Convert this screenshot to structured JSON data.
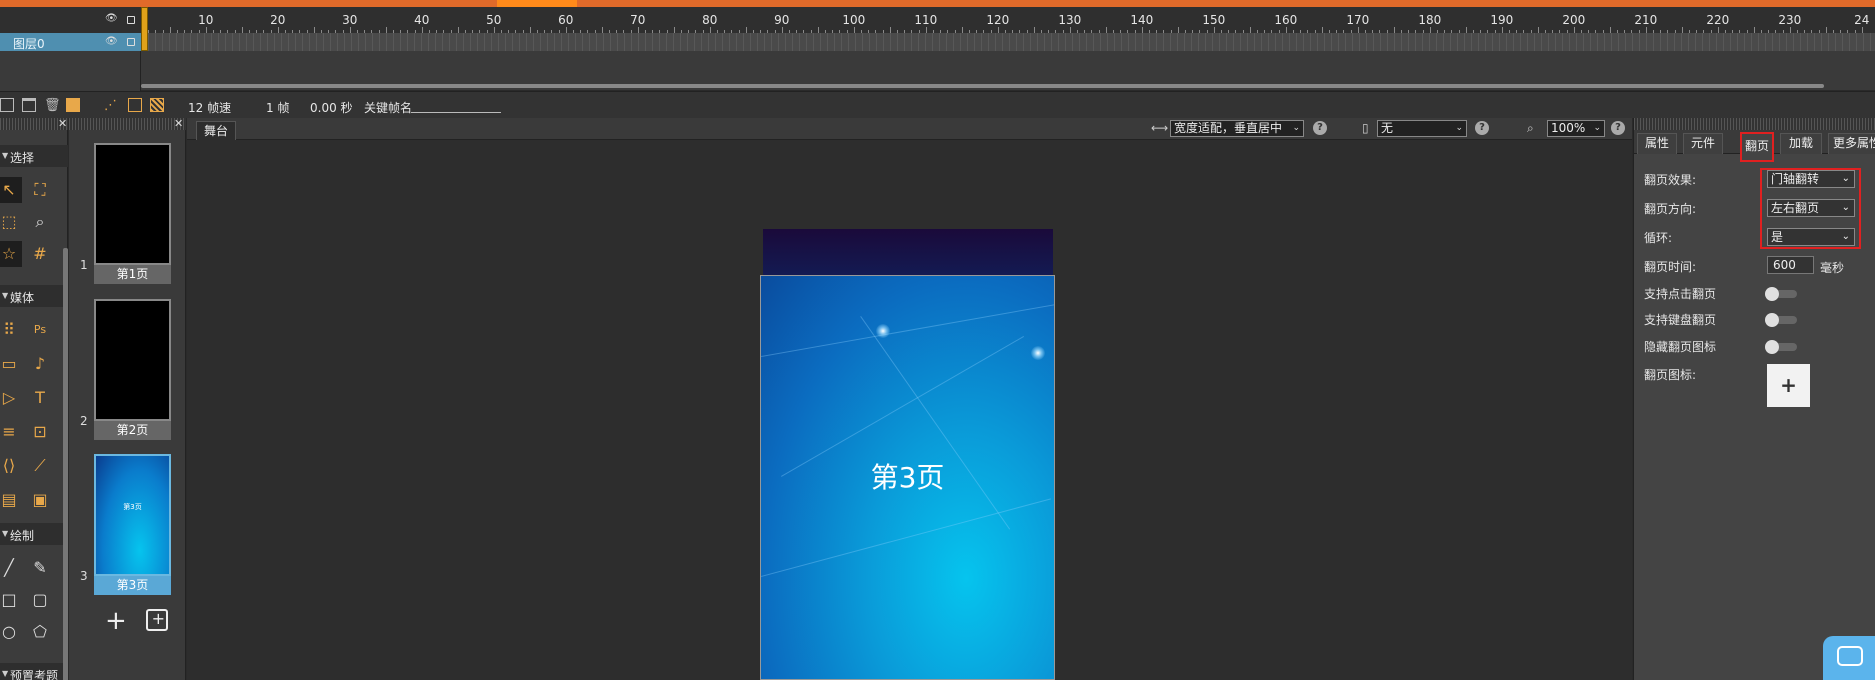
{
  "timeline": {
    "ruler_numbers": [
      "10",
      "20",
      "30",
      "40",
      "50",
      "60",
      "70",
      "80",
      "90",
      "100",
      "110",
      "120",
      "130",
      "140",
      "150",
      "160",
      "170",
      "180",
      "190",
      "200",
      "210",
      "220",
      "230",
      "24"
    ],
    "layer_name": "图层0",
    "status": {
      "fps": "12 帧速",
      "frame": "1 帧",
      "seconds": "0.00 秒",
      "keyframe_label": "关键帧名"
    }
  },
  "tools": {
    "sections": [
      {
        "label": "选择"
      },
      {
        "label": "媒体"
      },
      {
        "label": "绘制"
      },
      {
        "label": "预置考题"
      }
    ]
  },
  "pages": [
    {
      "num": "1",
      "label": "第1页"
    },
    {
      "num": "2",
      "label": "第2页"
    },
    {
      "num": "3",
      "label": "第3页",
      "mini_text": "第3页"
    }
  ],
  "stage": {
    "tab": "舞台",
    "fit_mode": "宽度适配，垂直居中",
    "device": "无",
    "zoom": "100%",
    "help": "?",
    "canvas_title": "第3页"
  },
  "props": {
    "tabs": [
      "属性",
      "元件",
      "翻页",
      "加载",
      "更多属性"
    ],
    "active_tab": "翻页",
    "rows": {
      "effect_label": "翻页效果:",
      "effect_value": "门轴翻转",
      "direction_label": "翻页方向:",
      "direction_value": "左右翻页",
      "loop_label": "循环:",
      "loop_value": "是",
      "time_label": "翻页时间:",
      "time_value": "600",
      "time_unit": "毫秒",
      "click_label": "支持点击翻页",
      "keyboard_label": "支持键盘翻页",
      "hide_icon_label": "隐藏翻页图标",
      "icon_label": "翻页图标:"
    },
    "add_symbol": "+"
  },
  "colors": {
    "accent_orange": "#e06a2a",
    "selection_blue": "#5aa8d6",
    "highlight_red": "#e02020"
  }
}
